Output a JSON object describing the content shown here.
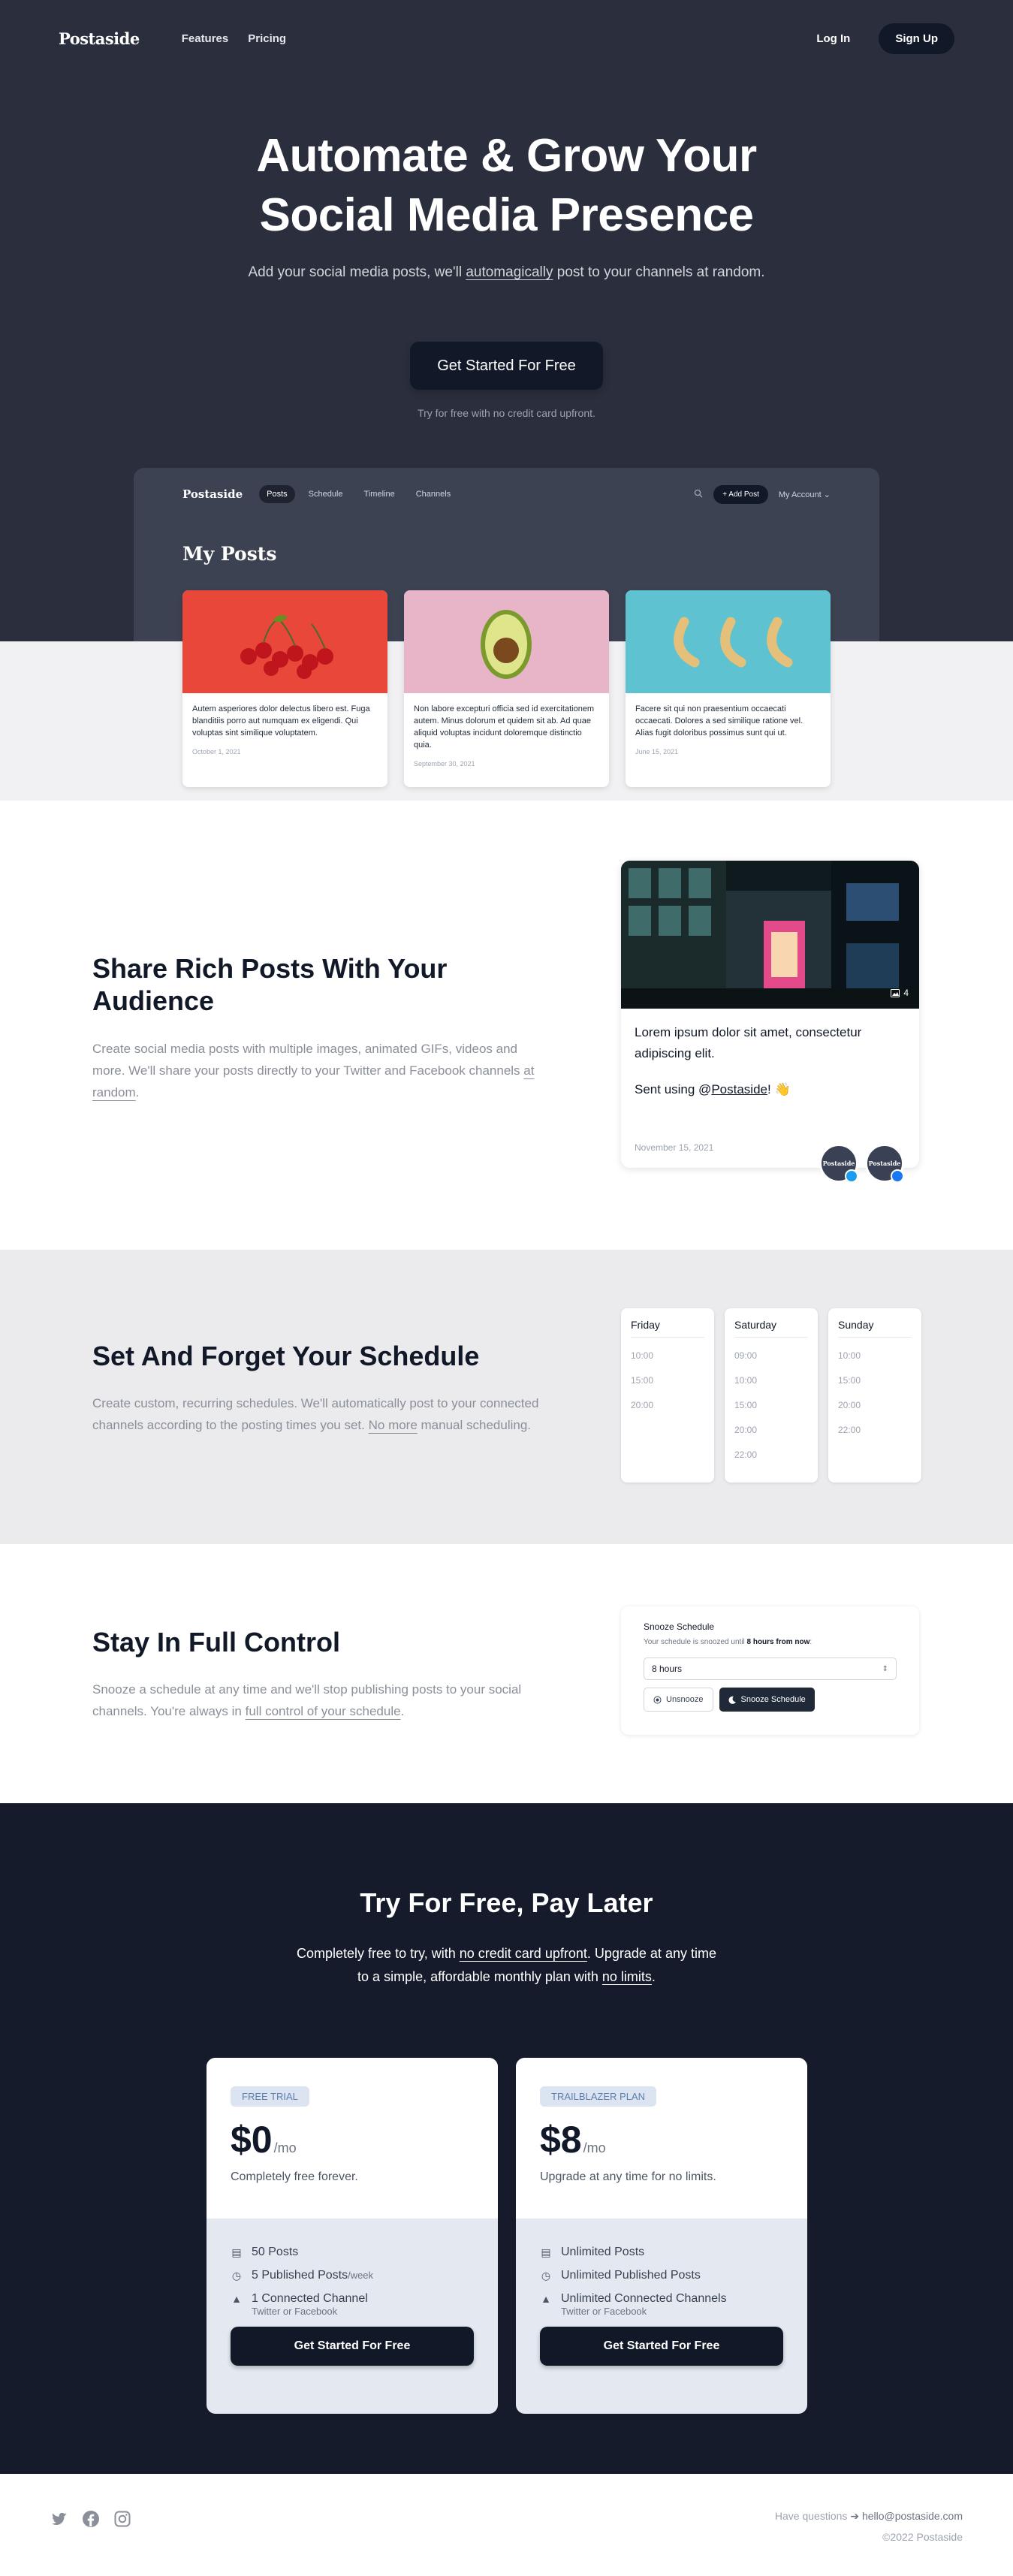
{
  "nav": {
    "logo": "Postaside",
    "links": [
      "Features",
      "Pricing"
    ],
    "login": "Log In",
    "signup": "Sign Up"
  },
  "hero": {
    "title_line1": "Automate & Grow Your",
    "title_line2": "Social Media Presence",
    "sub_before": "Add your social media posts, we'll ",
    "sub_underlined": "automagically",
    "sub_after": " post to your channels at random.",
    "cta": "Get Started For Free",
    "note": "Try for free with no credit card upfront."
  },
  "app": {
    "logo": "Postaside",
    "tabs": [
      "Posts",
      "Schedule",
      "Timeline",
      "Channels"
    ],
    "add_post": "+ Add Post",
    "account": "My Account",
    "heading": "My Posts",
    "cards": [
      {
        "text": "Autem asperiores dolor delectus libero est. Fuga blanditiis porro aut numquam ex eligendi. Qui voluptas sint similique voluptatem.",
        "date": "October 1, 2021",
        "image": "cherries",
        "bg": "#e8473a"
      },
      {
        "text": "Non labore excepturi officia sed id exercitationem autem. Minus dolorum et quidem sit ab. Ad quae aliquid voluptas incidunt doloremque distinctio quia.",
        "date": "September 30, 2021",
        "image": "avocado",
        "bg": "#e8b4c8"
      },
      {
        "text": "Facere sit qui non praesentium occaecati occaecati. Dolores a sed similique ratione vel. Alias fugit doloribus possimus sunt qui ut.",
        "date": "June 15, 2021",
        "image": "bananas",
        "bg": "#5ec2d0"
      }
    ]
  },
  "feature1": {
    "title": "Share Rich Posts With Your Audience",
    "text_before": "Create social media posts with multiple images, animated GIFs, videos and more. We'll share your posts directly to your Twitter and Facebook channels ",
    "text_underlined": "at random",
    "text_after": ".",
    "post": {
      "text": "Lorem ipsum dolor sit amet, consectetur adipiscing elit.",
      "sent_before": "Sent using @",
      "sent_link": "Postaside",
      "sent_after": "! 👋",
      "image_count": "4",
      "date": "November 15, 2021",
      "avatar_label": "Postaside"
    }
  },
  "feature2": {
    "title": "Set And Forget Your Schedule",
    "text_before": "Create custom, recurring schedules. We'll automatically post to your connected channels according to the posting times you set. ",
    "text_underlined": "No more",
    "text_after": " manual scheduling.",
    "days": [
      {
        "name": "Friday",
        "times": [
          "10:00",
          "15:00",
          "20:00"
        ]
      },
      {
        "name": "Saturday",
        "times": [
          "09:00",
          "10:00",
          "15:00",
          "20:00",
          "22:00"
        ]
      },
      {
        "name": "Sunday",
        "times": [
          "10:00",
          "15:00",
          "20:00",
          "22:00"
        ]
      }
    ]
  },
  "feature3": {
    "title": "Stay In Full Control",
    "text_before": "Snooze a schedule at any time and we'll stop publishing posts to your social channels. You're always in ",
    "text_underlined": "full control of your schedule",
    "text_after": ".",
    "snooze": {
      "title": "Snooze Schedule",
      "sub_before": "Your schedule is snoozed until ",
      "sub_bold": "8 hours from now",
      "sub_after": ":",
      "select_value": "8 hours",
      "unsnooze": "Unsnooze",
      "snooze": "Snooze Schedule"
    }
  },
  "pricing": {
    "title": "Try For Free, Pay Later",
    "sub_1": "Completely free to try, with ",
    "sub_u1": "no credit card upfront",
    "sub_2": ". Upgrade at any time",
    "sub_3": "to a simple, affordable monthly plan with ",
    "sub_u2": "no limits",
    "sub_4": ".",
    "plans": [
      {
        "badge": "FREE TRIAL",
        "price": "$0",
        "per": "/mo",
        "desc": "Completely free forever.",
        "f1": "50 Posts",
        "f2": "5 Published Posts",
        "f2_suffix": "/week",
        "f3": "1 Connected Channel",
        "f3_sub": "Twitter or Facebook",
        "cta": "Get Started For Free"
      },
      {
        "badge": "TRAILBLAZER PLAN",
        "price": "$8",
        "per": "/mo",
        "desc": "Upgrade at any time for no limits.",
        "f1": "Unlimited Posts",
        "f2": "Unlimited Published Posts",
        "f2_suffix": "",
        "f3": "Unlimited Connected Channels",
        "f3_sub": "Twitter or Facebook",
        "cta": "Get Started For Free"
      }
    ]
  },
  "footer": {
    "question": "Have questions",
    "email": "hello@postaside.com",
    "copyright": "©2022 Postaside",
    "icons": [
      "twitter-icon",
      "facebook-icon",
      "instagram-icon"
    ]
  }
}
